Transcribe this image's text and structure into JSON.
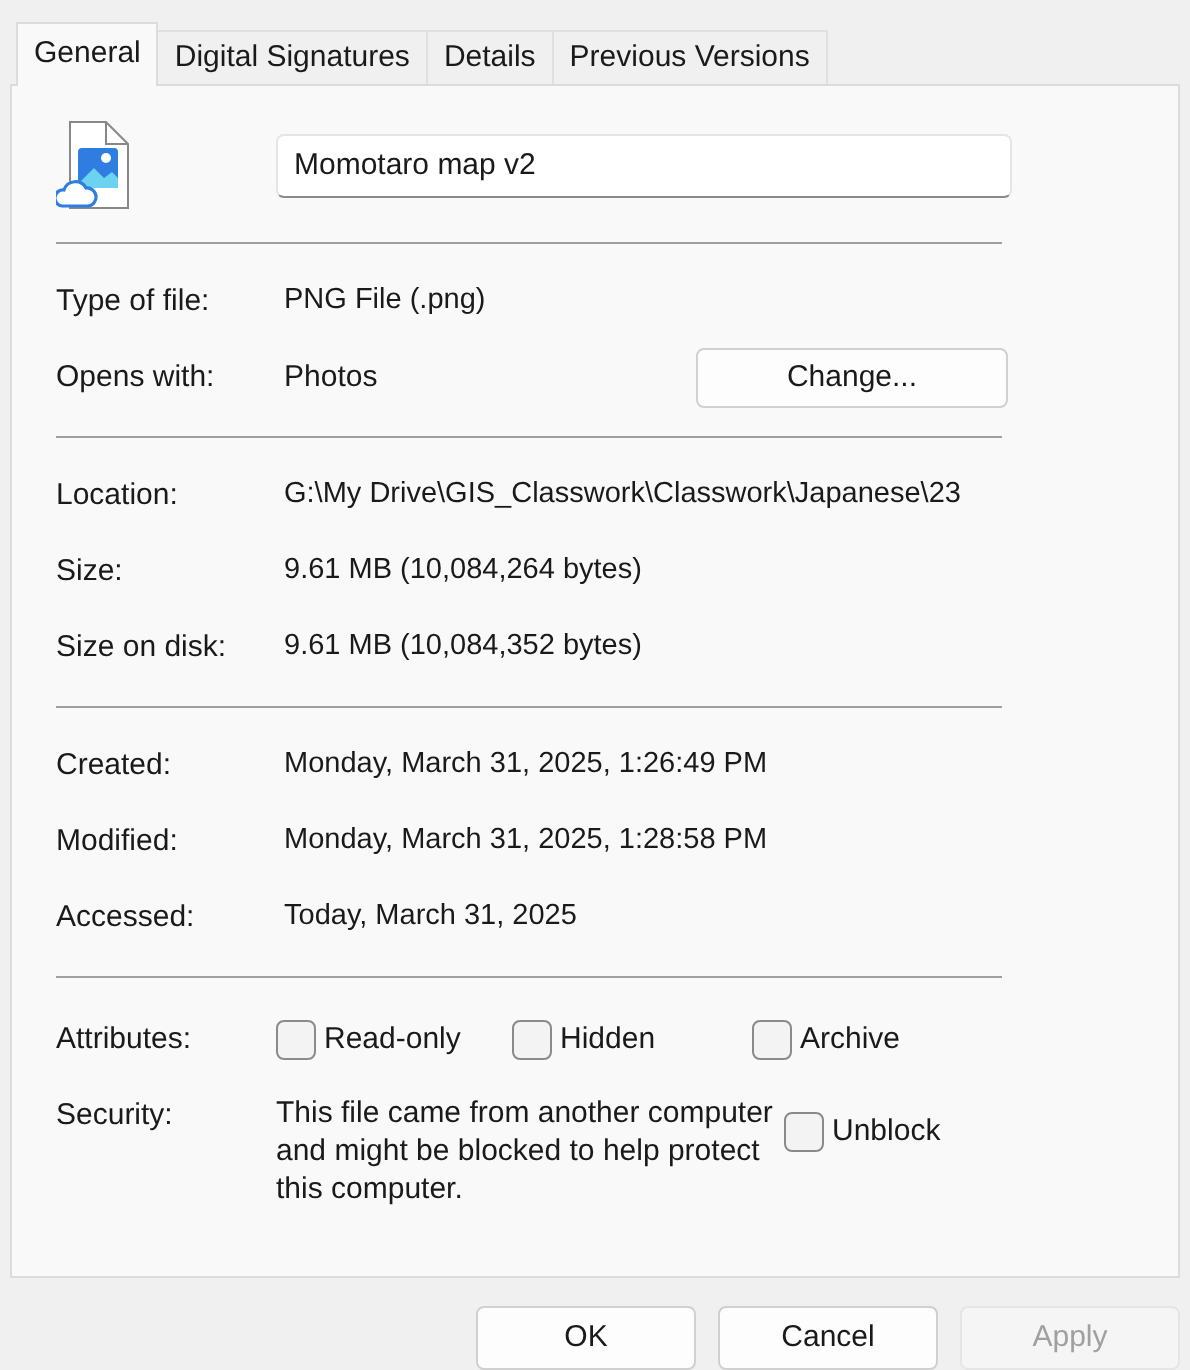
{
  "tabs": [
    {
      "label": "General",
      "selected": true
    },
    {
      "label": "Digital Signatures",
      "selected": false
    },
    {
      "label": "Details",
      "selected": false
    },
    {
      "label": "Previous Versions",
      "selected": false
    }
  ],
  "file_name": {
    "value": "Momotaro map v2"
  },
  "groups": [
    [
      {
        "label": "Type of file:",
        "value": "PNG File (.png)"
      },
      {
        "label": "Opens with:",
        "value": "Photos",
        "button": "Change..."
      }
    ],
    [
      {
        "label": "Location:",
        "value": "G:\\My Drive\\GIS_Classwork\\Classwork\\Japanese\\23"
      },
      {
        "label": "Size:",
        "value": "9.61 MB (10,084,264 bytes)"
      },
      {
        "label": "Size on disk:",
        "value": "9.61 MB (10,084,352 bytes)"
      }
    ],
    [
      {
        "label": "Created:",
        "value": "Monday, March 31, 2025, 1:26:49 PM"
      },
      {
        "label": "Modified:",
        "value": "Monday, March 31, 2025, 1:28:58 PM"
      },
      {
        "label": "Accessed:",
        "value": "Today, March 31, 2025"
      }
    ]
  ],
  "attributes": {
    "label": "Attributes:",
    "items": [
      {
        "label": "Read-only",
        "checked": false
      },
      {
        "label": "Hidden",
        "checked": false
      },
      {
        "label": "Archive",
        "checked": false
      }
    ]
  },
  "security": {
    "label": "Security:",
    "text": "This file came from another computer and might be blocked to help protect this computer.",
    "unblock": {
      "label": "Unblock",
      "checked": false
    }
  },
  "buttons": [
    {
      "label": "OK",
      "disabled": false
    },
    {
      "label": "Cancel",
      "disabled": false
    },
    {
      "label": "Apply",
      "disabled": true
    }
  ]
}
